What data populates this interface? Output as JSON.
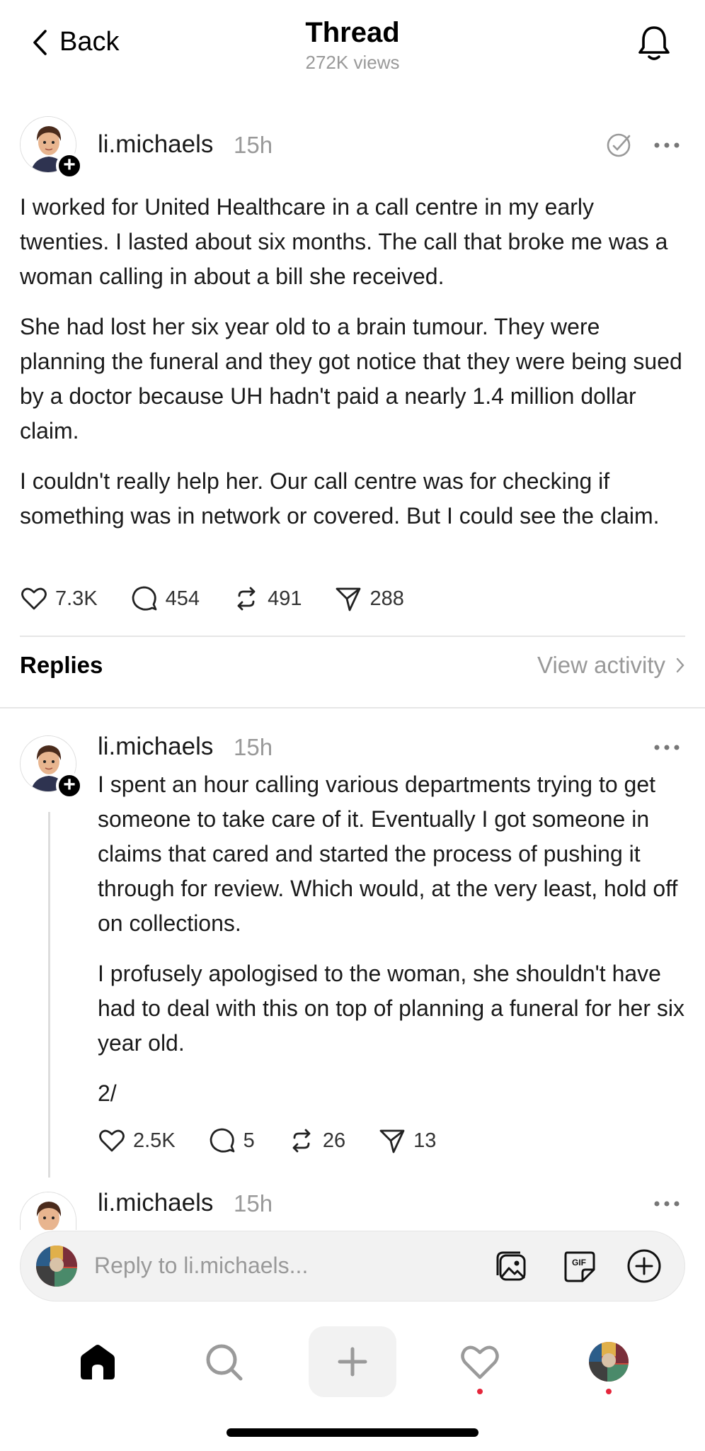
{
  "header": {
    "back_label": "Back",
    "title": "Thread",
    "views": "272K views"
  },
  "post": {
    "username": "li.michaels",
    "time": "15h",
    "paragraphs": [
      "I worked for United Healthcare in a call centre in my early twenties. I lasted about six months. The call that broke me was a woman calling in about a bill she received.",
      "She had lost her six year old to a brain tumour.  They were planning the funeral and they got notice that they were being sued by a doctor because UH hadn't paid a nearly 1.4 million dollar claim.",
      "I couldn't really help her. Our call centre was for checking if something was in network or covered.  But I could see the claim."
    ],
    "likes": "7.3K",
    "comments": "454",
    "reposts": "491",
    "shares": "288"
  },
  "replies_section": {
    "label": "Replies",
    "view_activity": "View activity"
  },
  "reply1": {
    "username": "li.michaels",
    "time": "15h",
    "paragraphs": [
      "I spent an hour calling various departments trying to get someone to take care of it.  Eventually I got someone in claims that cared and started the process of pushing it through for review.  Which would, at the very least, hold off on collections.",
      "I profusely apologised to the woman, she shouldn't have had to deal with this on top of planning a funeral for her six year old.",
      "2/"
    ],
    "likes": "2.5K",
    "comments": "5",
    "reposts": "26",
    "shares": "13"
  },
  "reply2": {
    "username": "li.michaels",
    "time": "15h"
  },
  "reply_bar": {
    "placeholder": "Reply to li.michaels..."
  },
  "colors": {
    "muted": "#999999",
    "notification_dot": "#e5263b",
    "reply_bar_bg": "#f2f2f2"
  },
  "icons": [
    "chevron-left-icon",
    "bell-icon",
    "more-icon",
    "heart-icon",
    "comment-icon",
    "repost-icon",
    "share-icon",
    "image-icon",
    "gif-icon",
    "plus-circle-icon",
    "home-icon",
    "search-icon",
    "plus-icon",
    "profile-icon"
  ]
}
